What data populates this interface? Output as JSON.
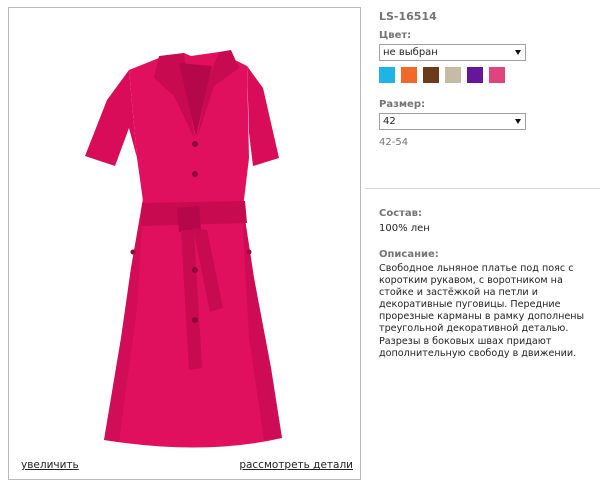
{
  "photo": {
    "zoom_link": "увеличить",
    "details_link": "рассмотреть детали",
    "dress_color": "#e0105f"
  },
  "product": {
    "sku": "LS-16514",
    "color": {
      "label": "Цвет:",
      "selected": "не выбран",
      "swatches": [
        {
          "name": "cyan",
          "hex": "#1eb4e4"
        },
        {
          "name": "orange",
          "hex": "#f2682a"
        },
        {
          "name": "brown",
          "hex": "#6b3b1b"
        },
        {
          "name": "beige",
          "hex": "#c6bca6"
        },
        {
          "name": "purple",
          "hex": "#66169a"
        },
        {
          "name": "pink",
          "hex": "#e0447e"
        }
      ]
    },
    "size": {
      "label": "Размер:",
      "selected": "42",
      "range": "42-54"
    },
    "composition": {
      "label": "Состав:",
      "value": "100% лен"
    },
    "description": {
      "label": "Описание:",
      "text": "Свободное льняное платье под пояс с коротким рукавом, с воротником на стойке и застёжкой на петли и декоративные пуговицы. Передние прорезные карманы в рамку дополнены треугольной декоративной деталью. Разрезы в боковых швах придают дополнительную свободу в движении."
    }
  }
}
